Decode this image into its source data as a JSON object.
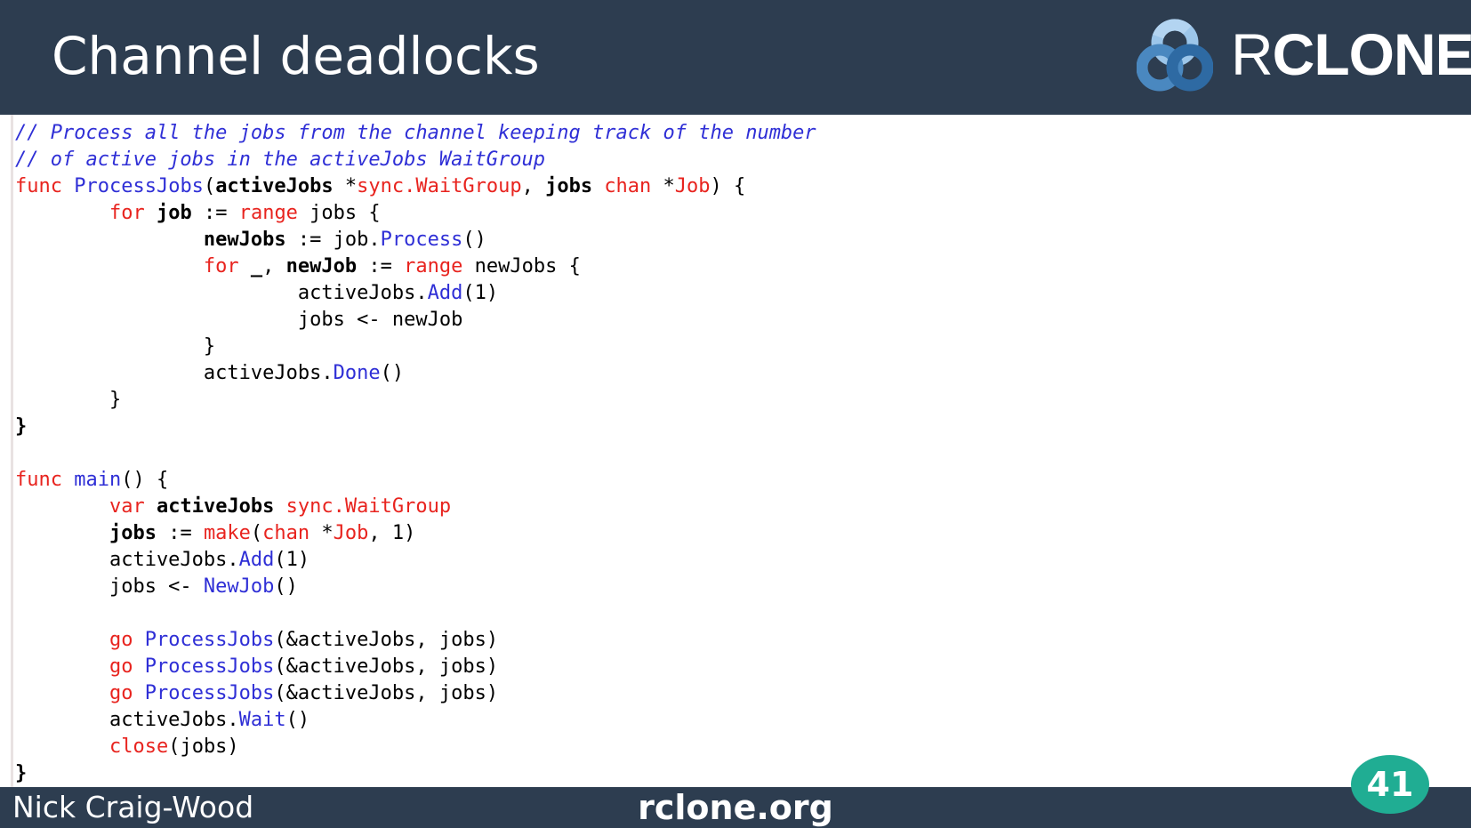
{
  "slide": {
    "title": "Channel deadlocks",
    "logo_text_r": "R",
    "logo_text_rest": "CLONE",
    "footer_author": "Nick Craig-Wood",
    "footer_site": "rclone.org",
    "page_number": "41"
  },
  "code": {
    "lines": [
      [
        {
          "t": "// Process all the jobs from the channel keeping track of the number",
          "c": "cm"
        }
      ],
      [
        {
          "t": "// of active jobs in the activeJobs WaitGroup",
          "c": "cm"
        }
      ],
      [
        {
          "t": "func",
          "c": "kw"
        },
        {
          "t": " "
        },
        {
          "t": "ProcessJobs",
          "c": "fn"
        },
        {
          "t": "("
        },
        {
          "t": "activeJobs",
          "c": "b"
        },
        {
          "t": " *"
        },
        {
          "t": "sync.WaitGroup",
          "c": "kw"
        },
        {
          "t": ", "
        },
        {
          "t": "jobs",
          "c": "b"
        },
        {
          "t": " "
        },
        {
          "t": "chan",
          "c": "kw"
        },
        {
          "t": " *"
        },
        {
          "t": "Job",
          "c": "kw"
        },
        {
          "t": ") {"
        }
      ],
      [
        {
          "t": "        "
        },
        {
          "t": "for",
          "c": "kw"
        },
        {
          "t": " "
        },
        {
          "t": "job",
          "c": "b"
        },
        {
          "t": " := "
        },
        {
          "t": "range",
          "c": "kw"
        },
        {
          "t": " jobs {"
        }
      ],
      [
        {
          "t": "                "
        },
        {
          "t": "newJobs",
          "c": "b"
        },
        {
          "t": " := job."
        },
        {
          "t": "Process",
          "c": "fn"
        },
        {
          "t": "()"
        }
      ],
      [
        {
          "t": "                "
        },
        {
          "t": "for",
          "c": "kw"
        },
        {
          "t": " "
        },
        {
          "t": "_",
          "c": "b"
        },
        {
          "t": ", "
        },
        {
          "t": "newJob",
          "c": "b"
        },
        {
          "t": " := "
        },
        {
          "t": "range",
          "c": "kw"
        },
        {
          "t": " newJobs {"
        }
      ],
      [
        {
          "t": "                        activeJobs."
        },
        {
          "t": "Add",
          "c": "fn"
        },
        {
          "t": "(1)"
        }
      ],
      [
        {
          "t": "                        jobs <- newJob"
        }
      ],
      [
        {
          "t": "                }"
        }
      ],
      [
        {
          "t": "                activeJobs."
        },
        {
          "t": "Done",
          "c": "fn"
        },
        {
          "t": "()"
        }
      ],
      [
        {
          "t": "        }"
        }
      ],
      [
        {
          "t": "}",
          "c": "b"
        }
      ],
      [
        {
          "t": ""
        }
      ],
      [
        {
          "t": "func",
          "c": "kw"
        },
        {
          "t": " "
        },
        {
          "t": "main",
          "c": "fn"
        },
        {
          "t": "() {"
        }
      ],
      [
        {
          "t": "        "
        },
        {
          "t": "var",
          "c": "kw"
        },
        {
          "t": " "
        },
        {
          "t": "activeJobs",
          "c": "b"
        },
        {
          "t": " "
        },
        {
          "t": "sync.WaitGroup",
          "c": "kw"
        }
      ],
      [
        {
          "t": "        "
        },
        {
          "t": "jobs",
          "c": "b"
        },
        {
          "t": " := "
        },
        {
          "t": "make",
          "c": "kw"
        },
        {
          "t": "("
        },
        {
          "t": "chan",
          "c": "kw"
        },
        {
          "t": " *"
        },
        {
          "t": "Job",
          "c": "kw"
        },
        {
          "t": ", 1)"
        }
      ],
      [
        {
          "t": "        activeJobs."
        },
        {
          "t": "Add",
          "c": "fn"
        },
        {
          "t": "(1)"
        }
      ],
      [
        {
          "t": "        jobs <- "
        },
        {
          "t": "NewJob",
          "c": "fn"
        },
        {
          "t": "()"
        }
      ],
      [
        {
          "t": ""
        }
      ],
      [
        {
          "t": "        "
        },
        {
          "t": "go",
          "c": "kw"
        },
        {
          "t": " "
        },
        {
          "t": "ProcessJobs",
          "c": "fn"
        },
        {
          "t": "(&activeJobs, jobs)"
        }
      ],
      [
        {
          "t": "        "
        },
        {
          "t": "go",
          "c": "kw"
        },
        {
          "t": " "
        },
        {
          "t": "ProcessJobs",
          "c": "fn"
        },
        {
          "t": "(&activeJobs, jobs)"
        }
      ],
      [
        {
          "t": "        "
        },
        {
          "t": "go",
          "c": "kw"
        },
        {
          "t": " "
        },
        {
          "t": "ProcessJobs",
          "c": "fn"
        },
        {
          "t": "(&activeJobs, jobs)"
        }
      ],
      [
        {
          "t": "        activeJobs."
        },
        {
          "t": "Wait",
          "c": "fn"
        },
        {
          "t": "()"
        }
      ],
      [
        {
          "t": "        "
        },
        {
          "t": "close",
          "c": "kw"
        },
        {
          "t": "(jobs)"
        }
      ],
      [
        {
          "t": "}",
          "c": "b"
        }
      ]
    ]
  },
  "colors": {
    "header_bg": "#2d3d50",
    "keyword": "#e8241f",
    "identifier_blue": "#2f2fd6",
    "badge": "#20ad93",
    "logo_light_blue": "#7fb0de",
    "logo_dark_blue": "#3f79ad"
  }
}
